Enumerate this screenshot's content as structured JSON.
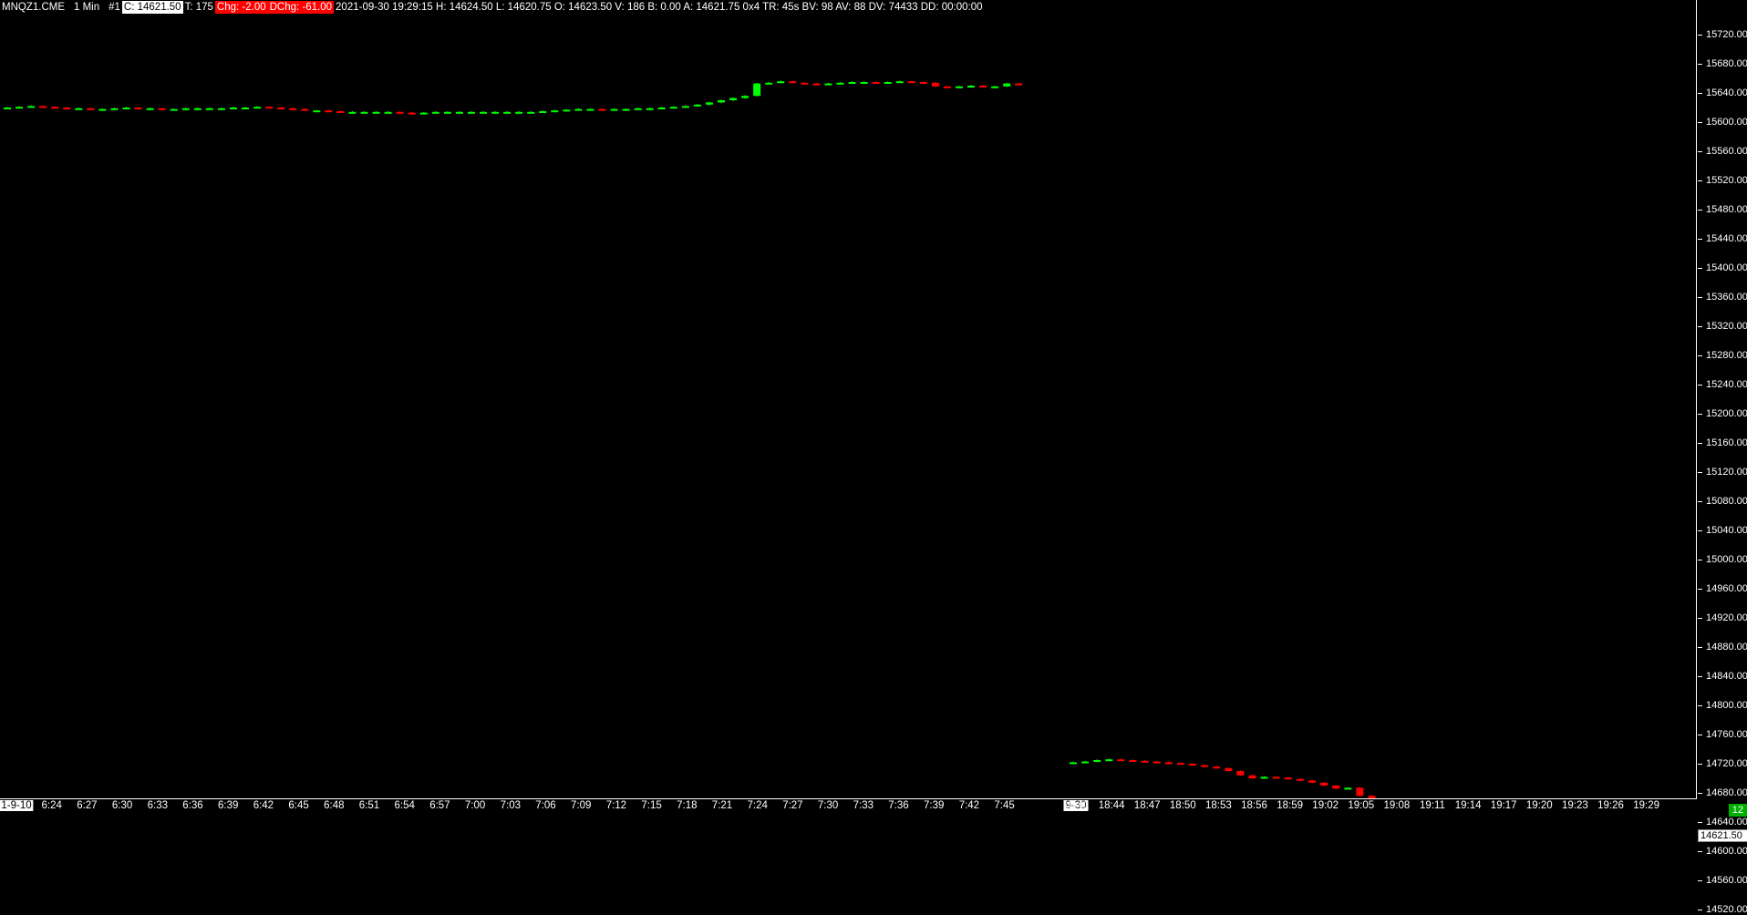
{
  "header": {
    "symbol": "MNQZ1.CME",
    "interval": "1 Min",
    "chart_no": "#1",
    "close": "C: 14621.50",
    "ticks": "T: 175",
    "chg": "Chg: -2.00",
    "dchg": "DChg: -61.00",
    "stats": "2021-09-30 19:29:15 H: 14624.50 L: 14620.75 O: 14623.50 V: 186 B: 0.00 A: 14621.75 0x4 TR: 45s BV: 98 AV: 88 DV: 74433 DD: 00:00:00"
  },
  "colors": {
    "up": "#00ff00",
    "down": "#ff0000",
    "background": "#000000",
    "axis": "#ffffff"
  },
  "last_price_label": "14621.50",
  "corner_badge": "12",
  "chart_data": {
    "type": "candlestick",
    "y_ticks": [
      "15720.00",
      "15680.00",
      "15640.00",
      "15600.00",
      "15560.00",
      "15520.00",
      "15480.00",
      "15440.00",
      "15400.00",
      "15360.00",
      "15320.00",
      "15280.00",
      "15240.00",
      "15200.00",
      "15160.00",
      "15120.00",
      "15080.00",
      "15040.00",
      "15000.00",
      "14960.00",
      "14920.00",
      "14880.00",
      "14840.00",
      "14800.00",
      "14760.00",
      "14720.00",
      "14680.00",
      "14640.00",
      "14600.00",
      "14560.00",
      "14520.00"
    ],
    "ylim": [
      14480,
      15750
    ],
    "x_ticks": [
      "1-9-10",
      "6:24",
      "6:27",
      "6:30",
      "6:33",
      "6:36",
      "6:39",
      "6:42",
      "6:45",
      "6:48",
      "6:51",
      "6:54",
      "6:57",
      "7:00",
      "7:03",
      "7:06",
      "7:09",
      "7:12",
      "7:15",
      "7:18",
      "7:21",
      "7:24",
      "7:27",
      "7:30",
      "7:33",
      "7:36",
      "7:39",
      "7:42",
      "7:45",
      "9-30",
      "18:41",
      "18:44",
      "18:47",
      "18:50",
      "18:53",
      "18:56",
      "18:59",
      "19:02",
      "19:05",
      "19:08",
      "19:11",
      "19:14",
      "19:17",
      "19:20",
      "19:23",
      "19:26",
      "19:29"
    ],
    "x_ticks_boxed": [
      "1-9-10",
      "9-30"
    ],
    "segments": [
      {
        "name": "session-1",
        "closes": [
          15620,
          15621,
          15622,
          15621,
          15620,
          15619,
          15619,
          15618,
          15618,
          15619,
          15620,
          15619,
          15619,
          15618,
          15618,
          15619,
          15619,
          15619,
          15619,
          15620,
          15620,
          15621,
          15620,
          15619,
          15618,
          15616,
          15616,
          15615,
          15614,
          15614,
          15614,
          15614,
          15614,
          15613,
          15612,
          15613,
          15614,
          15614,
          15614,
          15614,
          15614,
          15614,
          15614,
          15614,
          15614,
          15615,
          15616,
          15617,
          15618,
          15618,
          15617,
          15618,
          15618,
          15619,
          15619,
          15620,
          15621,
          15622,
          15624,
          15627,
          15630,
          15633,
          15636,
          15653,
          15654,
          15656,
          15654,
          15653,
          15652,
          15653,
          15654,
          15655,
          15655,
          15654,
          15655,
          15656,
          15655,
          15654,
          15649,
          15648,
          15649,
          15650,
          15648,
          15649,
          15653,
          15652
        ]
      },
      {
        "name": "session-2",
        "closes": [
          14722,
          14723,
          14725,
          14726,
          14725,
          14724,
          14723,
          14722,
          14721,
          14720,
          14718,
          14716,
          14714,
          14710,
          14704,
          14700,
          14702,
          14701,
          14699,
          14697,
          14694,
          14690,
          14686,
          14687,
          14676,
          14662,
          14646,
          14641,
          14644,
          14642,
          14618,
          14611,
          14609,
          14609,
          14605,
          14594,
          14588,
          14582,
          14585,
          14591,
          14597,
          14607,
          14606,
          14604,
          14607,
          14609,
          14611,
          14613,
          14615,
          14615,
          14614,
          14614,
          14616,
          14620,
          14621
        ]
      }
    ]
  }
}
